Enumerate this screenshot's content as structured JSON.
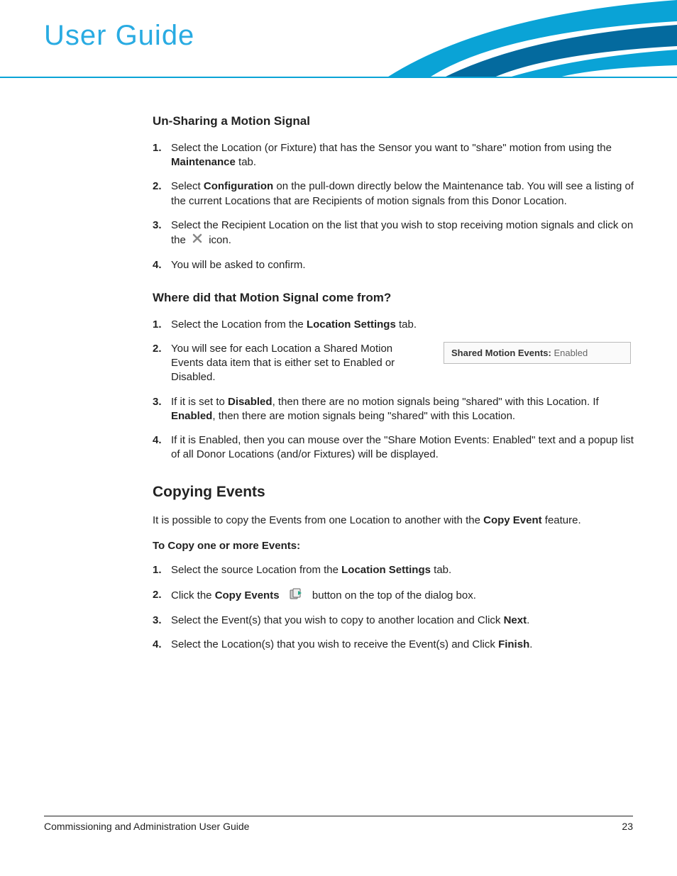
{
  "header": {
    "title": "User Guide"
  },
  "section1": {
    "heading": "Un-Sharing a Motion Signal",
    "steps": [
      {
        "pre": "Select the Location (or Fixture) that has the Sensor you want to \"share\" motion from using the ",
        "bold1": "Maintenance",
        "post1": " tab."
      },
      {
        "pre": "Select ",
        "bold1": "Configuration",
        "post1": " on the pull-down directly below the Maintenance tab. You will see a listing of the current Locations that are Recipients of motion signals from this Donor Location."
      },
      {
        "pre": "Select the Recipient Location on the list that you wish to stop receiving motion signals and click on the ",
        "icon": "x",
        "post1": " icon."
      },
      {
        "pre": "You will be asked to confirm."
      }
    ]
  },
  "section2": {
    "heading": "Where did that Motion Signal come from?",
    "steps": [
      {
        "pre": "Select the Location from the ",
        "bold1": "Location Settings",
        "post1": " tab."
      },
      {
        "pre": "You will see for each Location a Shared Motion Events data item that is either set to Enabled or Disabled.",
        "side_label": "Shared Motion Events:",
        "side_value": " Enabled"
      },
      {
        "pre": "If it is set to ",
        "bold1": "Disabled",
        "mid1": ", then there are no motion signals being \"shared\" with this Location.    If ",
        "bold2": "Enabled",
        "post1": ", then there are motion signals being \"shared\" with this Location."
      },
      {
        "pre": "If it is Enabled, then you can mouse over the \"Share Motion Events: Enabled\" text and a popup list of all Donor Locations (and/or Fixtures) will be displayed."
      }
    ]
  },
  "section3": {
    "heading": "Copying Events",
    "intro_pre": "It is possible to copy the Events from one Location to another with the ",
    "intro_bold": "Copy Event",
    "intro_post": " feature.",
    "subheading": "To Copy one or more Events:",
    "steps": [
      {
        "pre": "Select the source Location from the ",
        "bold1": "Location Settings",
        "post1": " tab."
      },
      {
        "pre": "Click the ",
        "bold1": "Copy Events",
        "icon": "copy",
        "post1": " button on the top of the dialog box."
      },
      {
        "pre": "Select the Event(s) that you wish to copy to another location and Click ",
        "bold1": "Next",
        "post1": "."
      },
      {
        "pre": "Select the Location(s) that you wish to receive the Event(s) and Click ",
        "bold1": "Finish",
        "post1": "."
      }
    ]
  },
  "footer": {
    "left": "Commissioning and Administration User Guide",
    "right": "23"
  }
}
